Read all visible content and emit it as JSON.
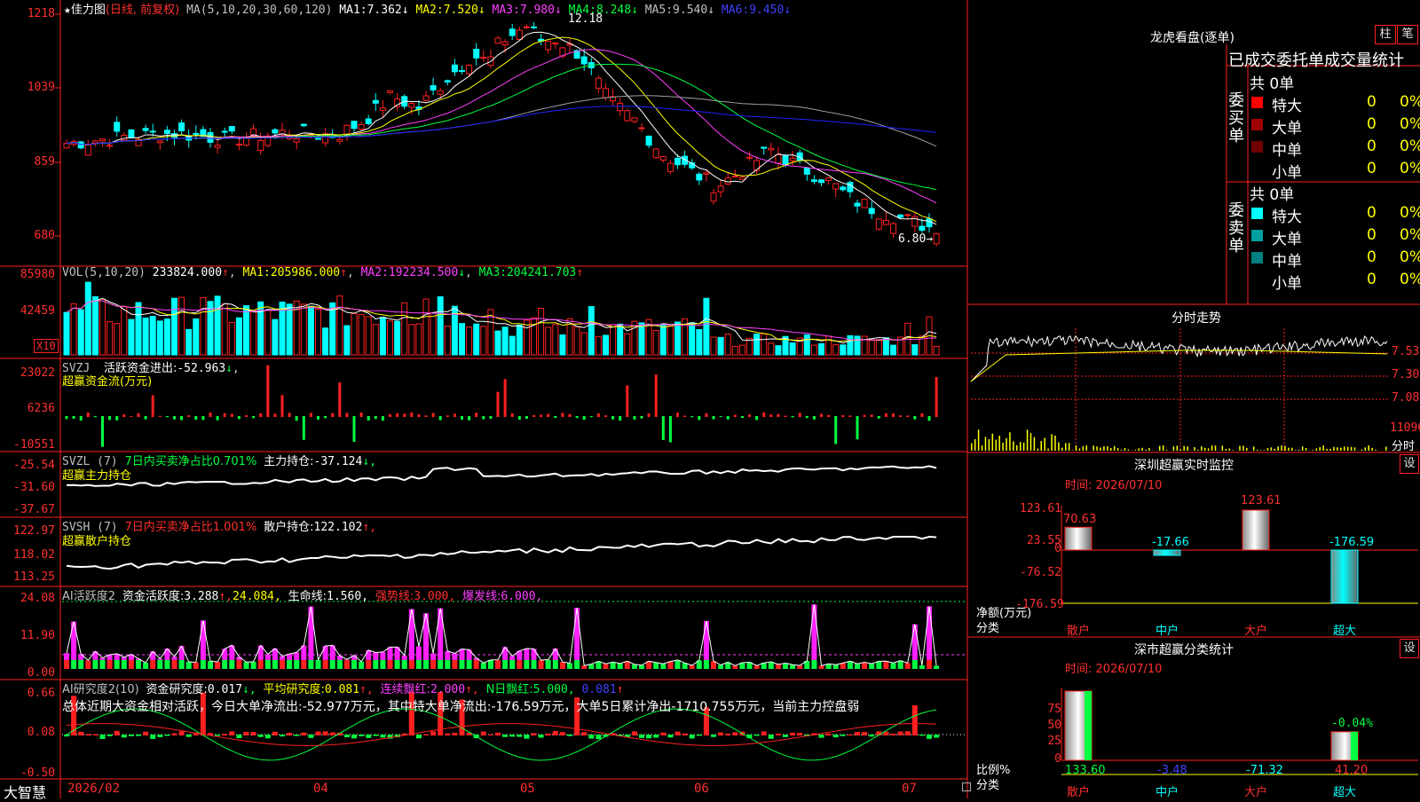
{
  "colors": {
    "up": "#ff2020",
    "down": "#00ffff",
    "border": "#ff2020",
    "ma1": "#ffffff",
    "ma2": "#ffff00",
    "ma3": "#ff40ff",
    "ma4": "#00ff40",
    "ma5": "#a0a0a0",
    "ma6": "#2020ff"
  },
  "price_panel": {
    "title_star": "★",
    "stock_name": "佳力图",
    "mode": "(日线, 前复权)",
    "ma_params": "MA(5,10,20,30,60,120)",
    "ma": [
      {
        "label": "MA1:",
        "value": "7.362",
        "arrow": "↓"
      },
      {
        "label": "MA2:",
        "value": "7.520",
        "arrow": "↓"
      },
      {
        "label": "MA3:",
        "value": "7.980",
        "arrow": "↓"
      },
      {
        "label": "MA4:",
        "value": "8.248",
        "arrow": "↓"
      },
      {
        "label": "MA5:",
        "value": "9.540",
        "arrow": "↓"
      },
      {
        "label": "MA6:",
        "value": "9.450",
        "arrow": "↓"
      }
    ],
    "yticks": [
      "1218",
      "1039",
      "859",
      "680"
    ],
    "high_label": "12.18",
    "low_label": "6.80→"
  },
  "vol_panel": {
    "title": "VOL(5,10,20)",
    "value": "233824.000",
    "arrow": "↑",
    "ma": [
      {
        "label": "MA1:",
        "value": "205986.000",
        "arrow": "↑"
      },
      {
        "label": "MA2:",
        "value": "192234.500",
        "arrow": "↓"
      },
      {
        "label": "MA3:",
        "value": "204241.703",
        "arrow": "↑"
      }
    ],
    "yticks": [
      "85980",
      "42459"
    ],
    "unit": "X10"
  },
  "svzj_panel": {
    "title": "SVZJ",
    "label": "活跃资金进出:",
    "value": "-52.963",
    "arrow": "↓",
    "subtitle": "超赢资金流(万元)",
    "yticks": [
      "23022",
      "6236",
      "-10551"
    ]
  },
  "svzl_panel": {
    "title": "SVZL (7)",
    "pct_text": "7日内买卖净占比0.701%",
    "label": "主力持仓:",
    "value": "-37.124",
    "arrow": "↓,",
    "subtitle": "超赢主力持仓",
    "yticks": [
      "-25.54",
      "-31.60",
      "-37.67"
    ]
  },
  "svsh_panel": {
    "title": "SVSH (7)",
    "pct_text": "7日内买卖净占比1.001%",
    "label": "散户持仓:",
    "value": "122.102",
    "arrow": "↑,",
    "subtitle": "超赢散户持仓",
    "yticks": [
      "122.97",
      "118.02",
      "113.25"
    ]
  },
  "ai_active_panel": {
    "title": "AI活跃度2",
    "label1": "资金活跃度:",
    "value1": "3.288",
    "arrow1": "↑,",
    "value2": "24.084,",
    "label3": "生命线:",
    "value3": "1.560,",
    "label4": "强势线:",
    "value4": "3.000,",
    "label5": "爆发线:",
    "value5": "6.000,",
    "yticks": [
      "24.08",
      "11.90",
      "0.00"
    ]
  },
  "ai_research_panel": {
    "title": "AI研究度2(10)",
    "label1": "资金研究度:",
    "value1": "0.017",
    "arrow1": "↓,",
    "label2": "平均研究度:",
    "value2": "0.081",
    "arrow2": "↑,",
    "label3": "连续飘红:",
    "value3": "2.000",
    "arrow3": "↑,",
    "label4": "N日飘红:",
    "value4": "5.000,",
    "value5": "0.081",
    "arrow5": "↑",
    "summary": "总体近期大资金相对活跃，今日大单净流出:-52.977万元，其中特大单净流出:-176.59万元，大单5日累计净出-1710.755万元，当前主力控盘弱",
    "yticks": [
      "0.66",
      "0.08",
      "-0.50"
    ]
  },
  "x_axis": {
    "logo": "大智慧",
    "dates": [
      "2026/02",
      "04",
      "05",
      "06",
      "07"
    ]
  },
  "dragon": {
    "title": "龙虎看盘(逐单)",
    "btn_bar": "柱",
    "btn_pen": "笔",
    "tabs": [
      "已成交",
      "委托单",
      "成交量统计"
    ],
    "buy_side_label": "委买单",
    "sell_side_label": "委卖单",
    "total": "共 0单",
    "buy_rows": [
      {
        "name": "特大",
        "qty": "0",
        "pct": "0%",
        "color": "#ff0000"
      },
      {
        "name": "大单",
        "qty": "0",
        "pct": "0%",
        "color": "#a00000"
      },
      {
        "name": "中单",
        "qty": "0",
        "pct": "0%",
        "color": "#700000"
      },
      {
        "name": "小单",
        "qty": "0",
        "pct": "0%",
        "color": "#000000"
      }
    ],
    "sell_rows": [
      {
        "name": "特大",
        "qty": "0",
        "pct": "0%",
        "color": "#00ffff"
      },
      {
        "name": "大单",
        "qty": "0",
        "pct": "0%",
        "color": "#00a0a0"
      },
      {
        "name": "中单",
        "qty": "0",
        "pct": "0%",
        "color": "#008080"
      },
      {
        "name": "小单",
        "qty": "0",
        "pct": "0%",
        "color": "#000000"
      }
    ]
  },
  "minute": {
    "title": "分时走势",
    "yticks": [
      "7.53",
      "7.30",
      "7.08"
    ],
    "vol_label": "11096",
    "footer": "分时"
  },
  "sz_monitor": {
    "title": "深圳超赢实时监控",
    "settings": "设",
    "time": "时间: 2026/07/10",
    "yticks": [
      "123.61",
      "23.55",
      "0",
      "-76.52",
      "-176.59"
    ],
    "bars": [
      {
        "name": "散户",
        "value": 70.63,
        "label": "70.63"
      },
      {
        "name": "中户",
        "value": -17.66,
        "label": "-17.66"
      },
      {
        "name": "大户",
        "value": 123.61,
        "label": "123.61"
      },
      {
        "name": "超大",
        "value": -176.59,
        "label": "-176.59"
      }
    ],
    "axis_label": "净额(万元)",
    "cat_label": "分类"
  },
  "sz_stats": {
    "title": "深市超赢分类统计",
    "settings": "设",
    "time": "时间: 2026/07/10",
    "yticks": [
      "75",
      "50",
      "25",
      "0"
    ],
    "bars": [
      {
        "name": "散户",
        "value": 133.6,
        "label": "133.60"
      },
      {
        "name": "中户",
        "value": -3.48,
        "label": "-3.48"
      },
      {
        "name": "大户",
        "value": -71.32,
        "label": "-71.32"
      },
      {
        "name": "超大",
        "value": 41.2,
        "label": "41.20"
      }
    ],
    "extra_label": "-0.04%",
    "axis_label": "比例%",
    "cat_label": "分类"
  }
}
